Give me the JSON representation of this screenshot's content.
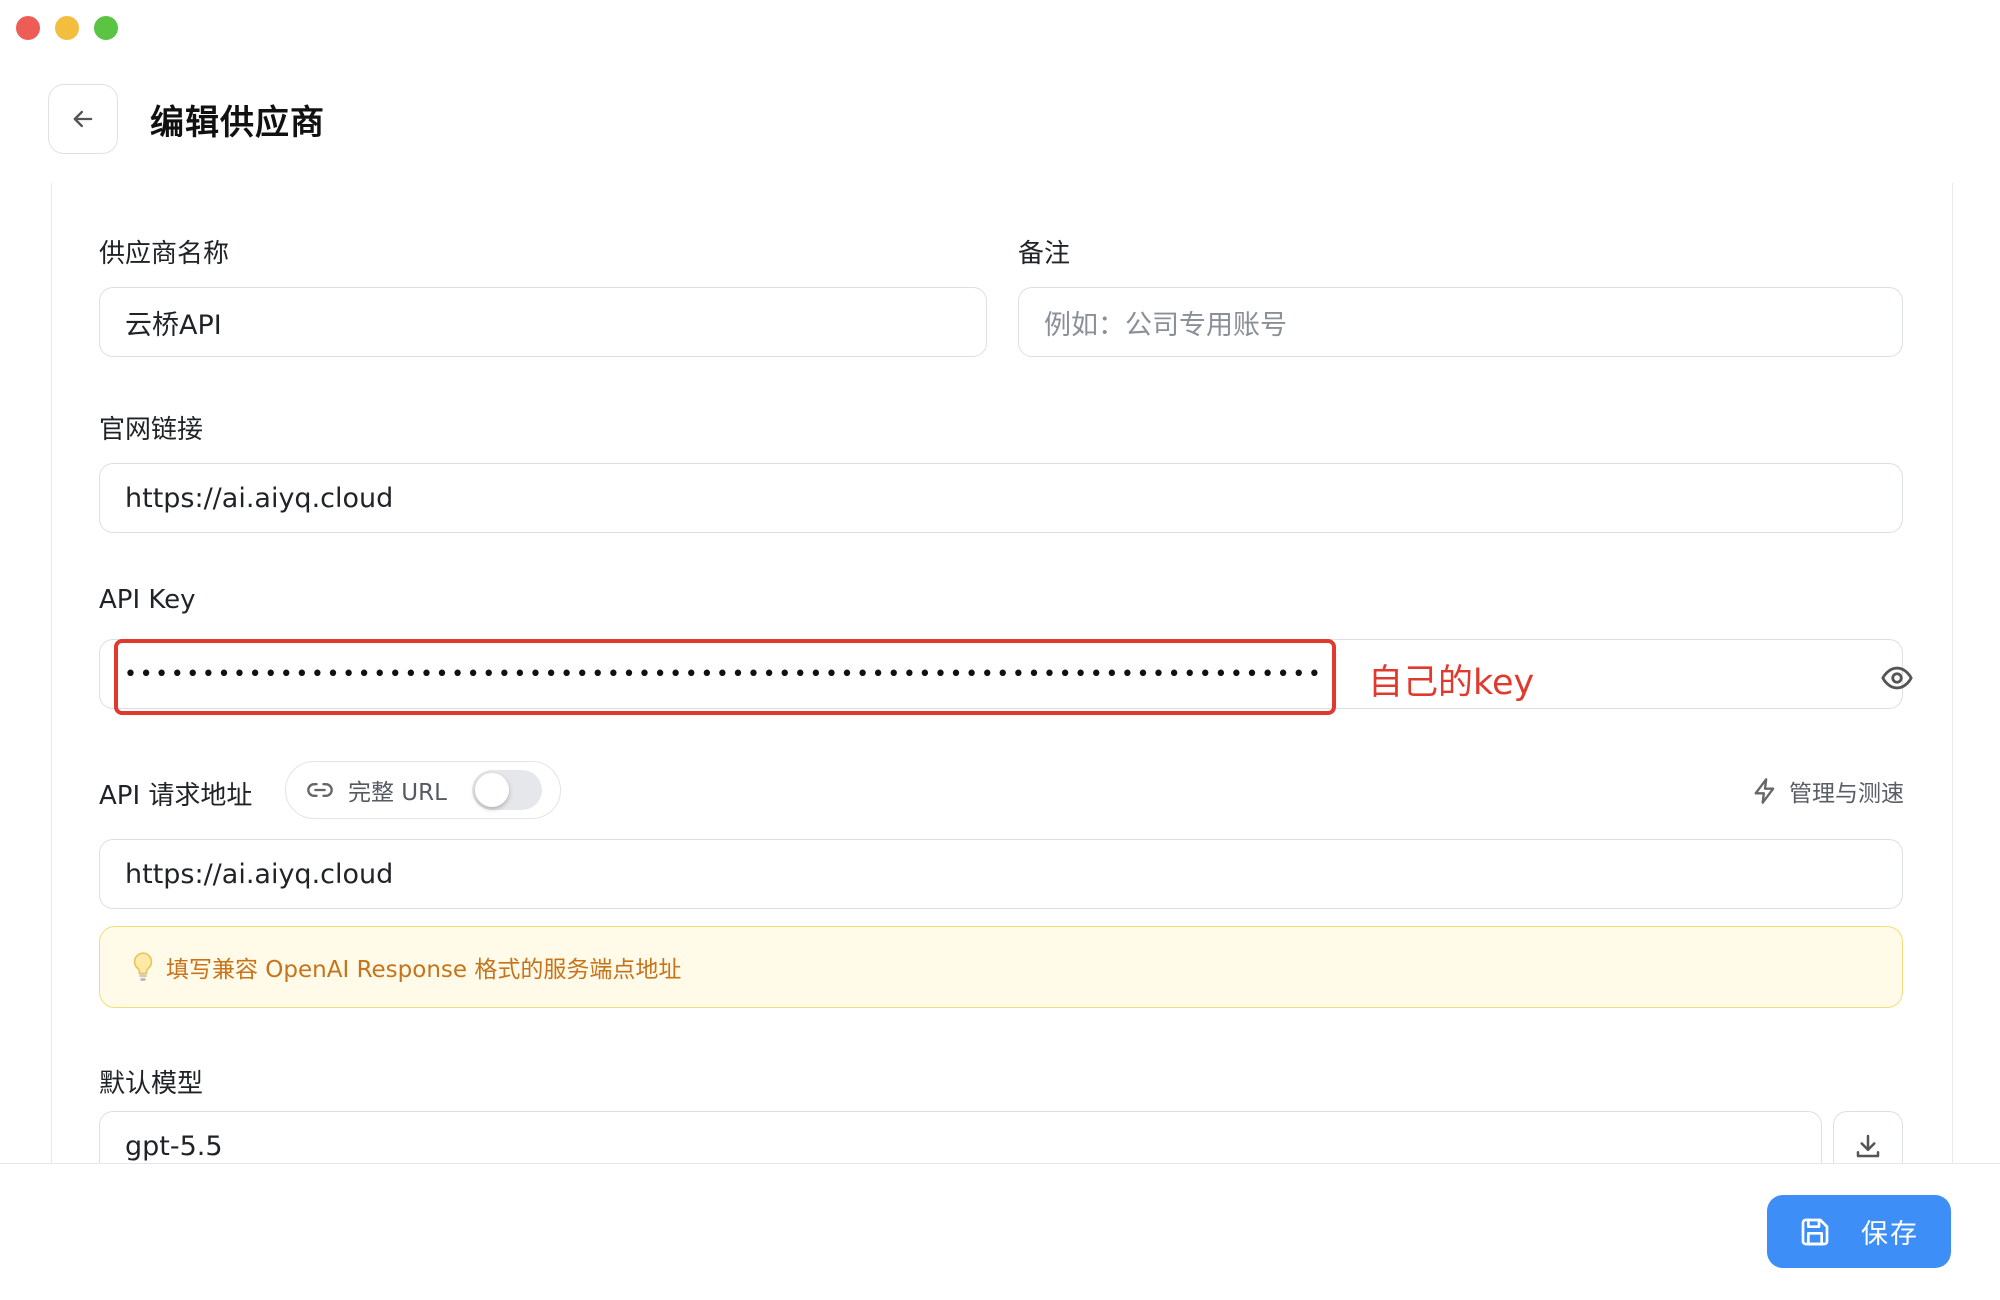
{
  "header": {
    "title": "编辑供应商"
  },
  "form": {
    "provider_name": {
      "label": "供应商名称",
      "value": "云桥API"
    },
    "note": {
      "label": "备注",
      "placeholder": "例如：公司专用账号"
    },
    "website": {
      "label": "官网链接",
      "value": "https://ai.aiyq.cloud"
    },
    "api_key": {
      "label": "API Key",
      "value": "•••••••••••••••••••••••••••••••••••••••••••••••••••••••••••••••••••••••••••••",
      "annotation": "自己的key"
    },
    "api_url": {
      "label": "API 请求地址",
      "full_url_toggle_label": "完整 URL",
      "full_url_enabled": false,
      "manage_label": "管理与测速",
      "value": "https://ai.aiyq.cloud",
      "hint": "填写兼容 OpenAI Response 格式的服务端点地址"
    },
    "default_model": {
      "label": "默认模型",
      "value": "gpt-5.5"
    }
  },
  "footer": {
    "save_label": "保存"
  },
  "colors": {
    "accent": "#3e8ef7",
    "annotation": "#e03a2e",
    "hint_text": "#c7731c",
    "hint_bg": "#fffbe8"
  },
  "icons": [
    "back-arrow-icon",
    "eye-icon",
    "link-icon",
    "lightning-icon",
    "lightbulb-icon",
    "download-icon",
    "save-icon"
  ]
}
